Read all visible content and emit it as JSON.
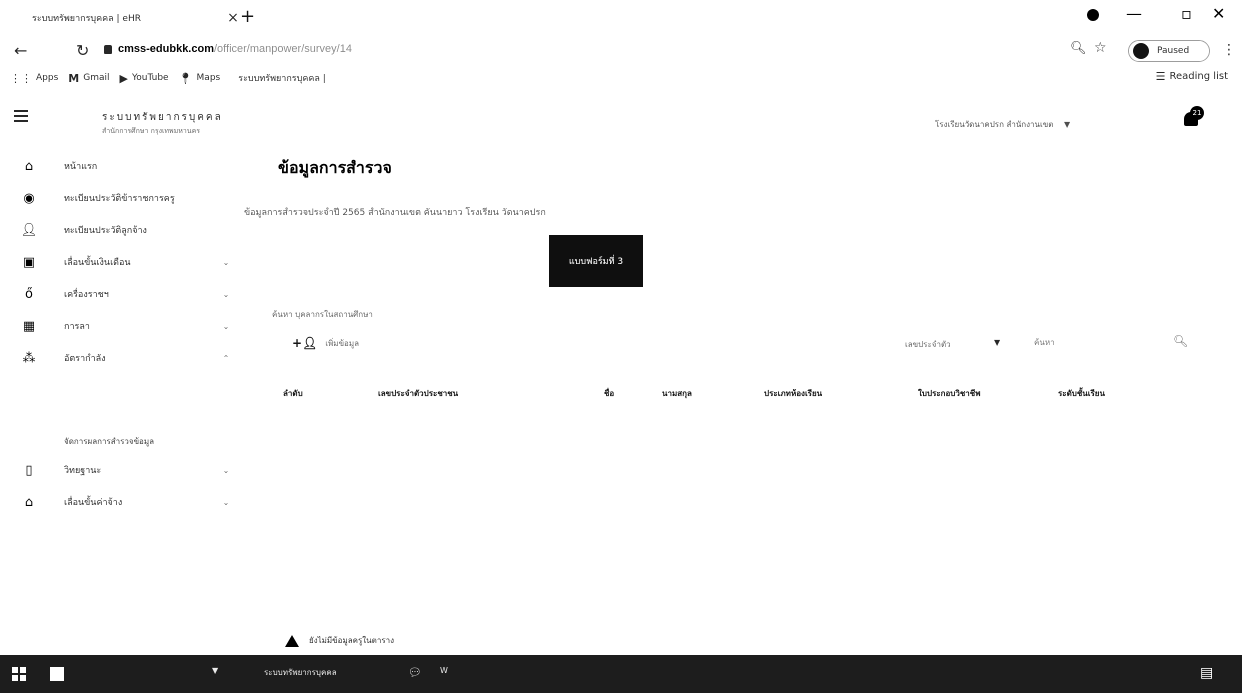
{
  "browser": {
    "tab_title": "ระบบทรัพยากรบุคคล | eHR",
    "tab_close": "×",
    "new_tab": "+",
    "url_host": "cmss-edubkk.com",
    "url_path": "/officer/manpower/survey/14",
    "paused_label": "Paused",
    "bookmarks": [
      {
        "icon": "apps-icon",
        "label": "Apps"
      },
      {
        "icon": "gmail-icon",
        "label": "Gmail"
      },
      {
        "icon": "youtube-icon",
        "label": "YouTube"
      },
      {
        "icon": "maps-icon",
        "label": "Maps"
      },
      {
        "icon": "page-icon",
        "label": "ระบบทรัพยากรบุคคล |"
      }
    ],
    "reading_list": "Reading list"
  },
  "header": {
    "brand_title": "ระบบทรัพยากรบุคคล",
    "brand_subtitle": "สำนักการศึกษา กรุงเทพมหานคร",
    "user_menu": "โรงเรียนวัดนาคปรก สำนักงานเขต",
    "notification_count": "21"
  },
  "sidebar": {
    "items": [
      {
        "icon": "home-icon",
        "label": "หน้าแรก",
        "chevron": ""
      },
      {
        "icon": "teacher-icon",
        "label": "ทะเบียนประวัติข้าราชการครู",
        "chevron": ""
      },
      {
        "icon": "person-icon",
        "label": "ทะเบียนประวัติลูกจ้าง",
        "chevron": ""
      },
      {
        "icon": "money-icon",
        "label": "เลื่อนขั้นเงินเดือน",
        "chevron": "⌄"
      },
      {
        "icon": "medal-icon",
        "label": "เครื่องราชฯ",
        "chevron": "⌄"
      },
      {
        "icon": "calendar-icon",
        "label": "การลา",
        "chevron": "⌄"
      },
      {
        "icon": "group-icon",
        "label": "อัตรากำลัง",
        "chevron": "⌃"
      },
      {
        "icon": "",
        "label": "จัดการผลการสำรวจข้อมูล",
        "chevron": ""
      },
      {
        "icon": "book-icon",
        "label": "วิทยฐานะ",
        "chevron": "⌄"
      },
      {
        "icon": "home-icon",
        "label": "เลื่อนขั้นค่าจ้าง",
        "chevron": "⌄"
      }
    ]
  },
  "main": {
    "title": "ข้อมูลการสำรวจ",
    "description": "ข้อมูลการสำรวจประจำปี 2565 สำนักงานเขต คันนายาว โรงเรียน วัดนาคปรก",
    "form_button": "แบบฟอร์มที่ 3",
    "filter_label": "ค้นหา บุคลากรในสถานศึกษา",
    "add_label": "เพิ่มข้อมูล",
    "select_value": "เลขประจำตัว",
    "search_placeholder": "ค้นหา",
    "table_headers": [
      "ลำดับ",
      "เลขประจำตัวประชาชน",
      "ชื่อ",
      "นามสกุล",
      "ประเภทห้องเรียน",
      "ใบประกอบวิชาชีพ",
      "ระดับชั้นเรียน"
    ],
    "notice": "ยังไม่มีข้อมูลครูในตาราง"
  },
  "taskbar": {
    "item1": "ระบบทรัพยากรบุคคล",
    "item2": "W"
  }
}
